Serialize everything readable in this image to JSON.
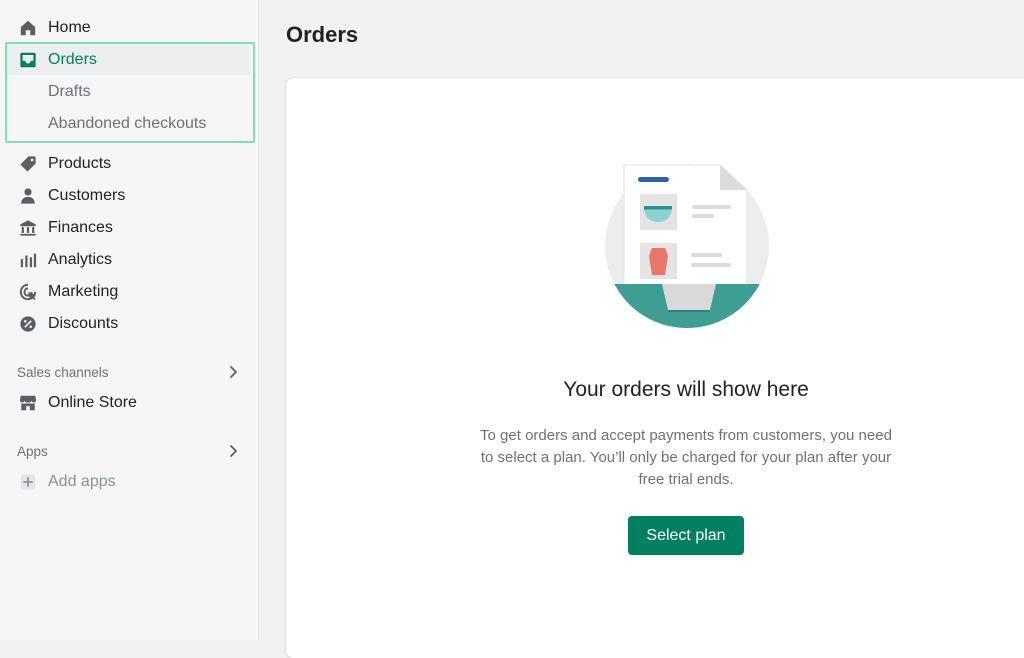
{
  "sidebar": {
    "home": {
      "label": "Home",
      "icon": "home-icon"
    },
    "orders": {
      "label": "Orders",
      "icon": "inbox-icon"
    },
    "drafts": {
      "label": "Drafts"
    },
    "abandoned": {
      "label": "Abandoned checkouts"
    },
    "products": {
      "label": "Products",
      "icon": "tag-icon"
    },
    "customers": {
      "label": "Customers",
      "icon": "person-icon"
    },
    "finances": {
      "label": "Finances",
      "icon": "bank-icon"
    },
    "analytics": {
      "label": "Analytics",
      "icon": "bar-chart-icon"
    },
    "marketing": {
      "label": "Marketing",
      "icon": "target-icon"
    },
    "discounts": {
      "label": "Discounts",
      "icon": "discount-icon"
    },
    "sales_channels": {
      "label": "Sales channels"
    },
    "online_store": {
      "label": "Online Store",
      "icon": "store-icon"
    },
    "apps": {
      "label": "Apps"
    },
    "add_apps": {
      "label": "Add apps",
      "icon": "plus-icon"
    }
  },
  "main": {
    "title": "Orders",
    "empty_state": {
      "heading": "Your orders will show here",
      "body": "To get orders and accept payments from customers, you need to select a plan. You’ll only be charged for your plan after your free trial ends.",
      "button_label": "Select plan"
    }
  },
  "colors": {
    "accent": "#008060",
    "active_text": "#007f5f",
    "highlight_border": "#7ee0b8",
    "illustration_teal": "#3f9e94"
  }
}
